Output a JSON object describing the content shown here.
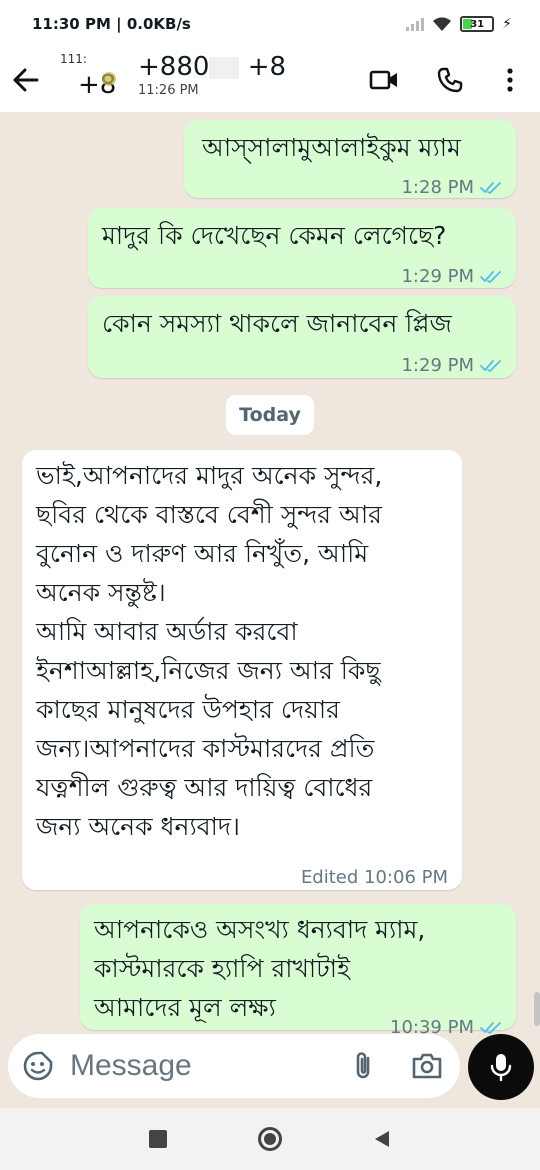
{
  "status_bar": {
    "time": "11:30 PM",
    "network_speed": "0.0KB/s",
    "battery_level": "31",
    "battery_percent": 31,
    "icons": [
      "signal-icon",
      "wifi-icon",
      "battery-icon",
      "charging-icon"
    ]
  },
  "header": {
    "avatar_top_text": "111:",
    "avatar_text": "+8",
    "contact_name_a": "+880",
    "contact_name_b": "+8",
    "subtitle": "11:26 PM",
    "icons": [
      "back-arrow-icon",
      "video-call-icon",
      "phone-call-icon",
      "more-options-icon"
    ]
  },
  "messages": [
    {
      "direction": "out",
      "text": "আস্সালামুআলাইকুম ম্যাম",
      "time": "1:28 PM",
      "status": "read"
    },
    {
      "direction": "out",
      "text": "মাদুর কি দেখেছেন কেমন লেগেছে?",
      "time": "1:29 PM",
      "status": "read"
    },
    {
      "direction": "out",
      "text": "কোন সমস্যা থাকলে জানাবেন প্লিজ",
      "time": "1:29 PM",
      "status": "read"
    },
    {
      "direction": "in",
      "text": "ভাই,আপনাদের মাদুর অনেক সুন্দর,\nছবির থেকে বাস্তবে বেশী সুন্দর আর\nবুনোন ও দারুণ আর নিখুঁত, আমি\nঅনেক সন্তুষ্ট।\nআমি আবার অর্ডার করবো\nইনশাআল্লাহ,নিজের জন্য আর কিছু\nকাছের মানুষদের উপহার দেয়ার\nজন্য।আপনাদের কাস্টমারদের প্রতি\nযত্নশীল গুরুত্ব আর দায়িত্ব বোধের\nজন্য অনেক ধন্যবাদ।",
      "time": "Edited 10:06 PM"
    },
    {
      "direction": "out",
      "text": "আপনাকেও অসংখ্য ধন্যবাদ ম্যাম,\nকাস্টমারকে হ্যাপি রাখাটাই\nআমাদের মূল লক্ষ্য",
      "time": "10:39 PM",
      "status": "read"
    }
  ],
  "day_divider": "Today",
  "composer": {
    "placeholder": "Message",
    "icons": [
      "emoji-icon",
      "attach-icon",
      "camera-icon",
      "mic-icon"
    ]
  },
  "nav_bar": {
    "icons": [
      "recents-square-icon",
      "home-circle-icon",
      "back-triangle-icon"
    ]
  },
  "colors": {
    "chat_background": "#efe7de",
    "outgoing_bubble": "#d9fdd3",
    "incoming_bubble": "#ffffff",
    "read_ticks": "#53bdeb",
    "meta_text": "#667781"
  }
}
